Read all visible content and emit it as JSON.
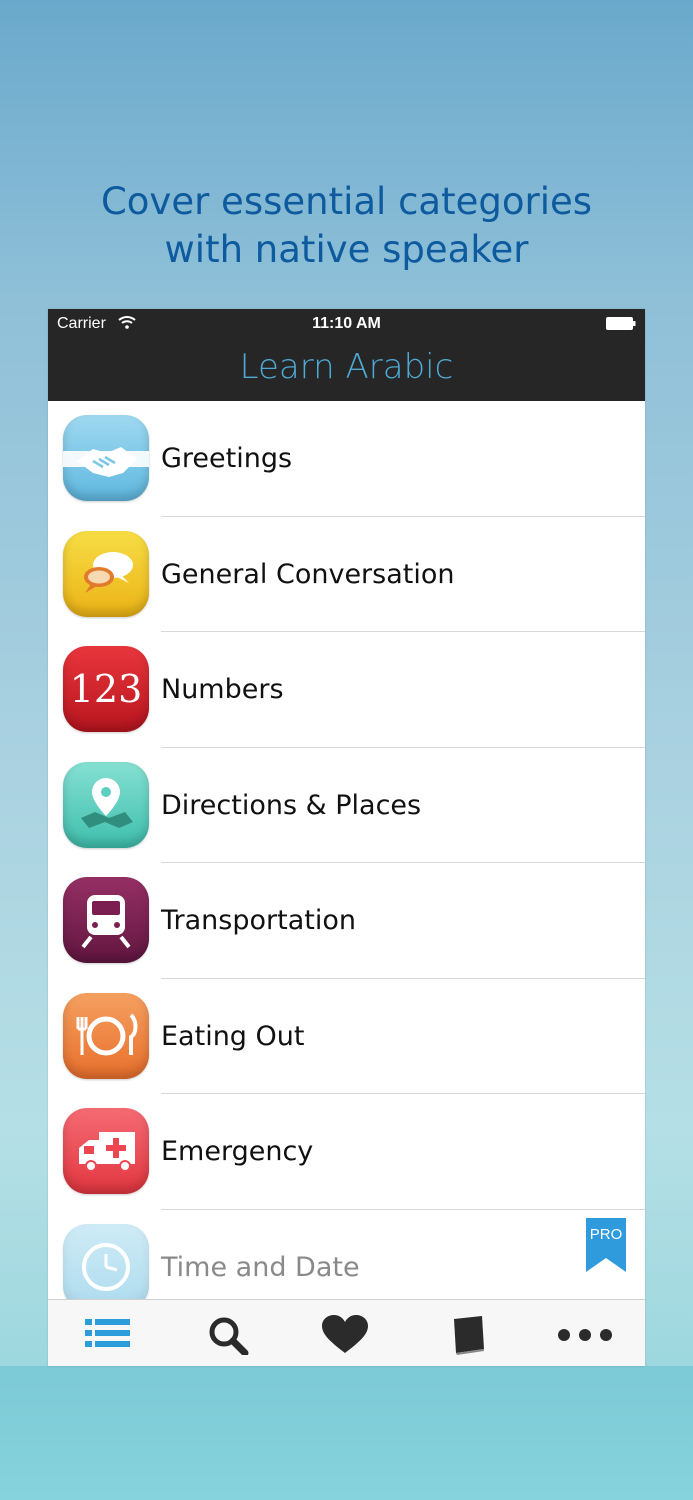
{
  "headline": {
    "line1": "Cover essential categories",
    "line2": "with native speaker"
  },
  "status_bar": {
    "carrier": "Carrier",
    "time": "11:10 AM"
  },
  "nav": {
    "title": "Learn Arabic"
  },
  "categories": [
    {
      "label": "Greetings",
      "icon": "handshake-icon",
      "color": "#7cc7e6"
    },
    {
      "label": "General Conversation",
      "icon": "speech-bubbles-icon",
      "color": "#f2c81e"
    },
    {
      "label": "Numbers",
      "icon": "numbers-icon",
      "icon_text": "123",
      "color": "#d8262e"
    },
    {
      "label": "Directions & Places",
      "icon": "map-pin-icon",
      "color": "#5ccfbf"
    },
    {
      "label": "Transportation",
      "icon": "train-icon",
      "color": "#7a1f4f"
    },
    {
      "label": "Eating Out",
      "icon": "plate-cutlery-icon",
      "color": "#f08040"
    },
    {
      "label": "Emergency",
      "icon": "ambulance-icon",
      "color": "#ee4650"
    },
    {
      "label": "Time and Date",
      "icon": "clock-icon",
      "color": "#7cc7e6",
      "badge": "PRO"
    }
  ],
  "tabs": [
    {
      "name": "list",
      "icon": "list-icon",
      "active": true
    },
    {
      "name": "search",
      "icon": "search-icon",
      "active": false
    },
    {
      "name": "favorites",
      "icon": "heart-icon",
      "active": false
    },
    {
      "name": "book",
      "icon": "book-icon",
      "active": false
    },
    {
      "name": "more",
      "icon": "more-icon",
      "active": false
    }
  ],
  "colors": {
    "headline": "#0e5a9e",
    "nav_title": "#4ea9d4",
    "tab_active": "#2c9ddb",
    "tab_inactive": "#2b2b2b",
    "pro_badge": "#2f9bdc"
  }
}
